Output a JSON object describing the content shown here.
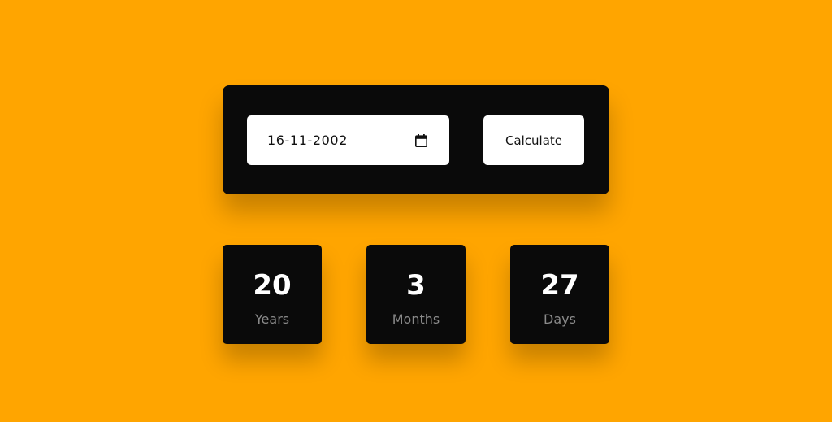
{
  "date_input": {
    "value": "16-11-2002",
    "icon": "calendar-icon"
  },
  "calculate_button": {
    "label": "Calculate"
  },
  "results": {
    "years": {
      "value": "20",
      "label": "Years"
    },
    "months": {
      "value": "3",
      "label": "Months"
    },
    "days": {
      "value": "27",
      "label": "Days"
    }
  },
  "colors": {
    "background": "#ffa500",
    "panel": "#0a0a0a",
    "text_light": "#ffffff",
    "label_muted": "#8a8a8a"
  }
}
